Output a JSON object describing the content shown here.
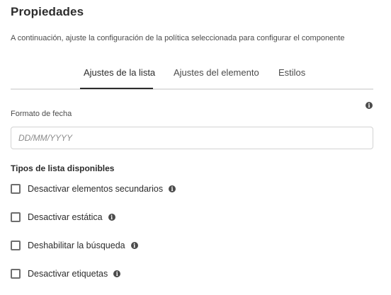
{
  "header": {
    "title": "Propiedades",
    "description": "A continuación, ajuste la configuración de la política seleccionada para configurar el componente"
  },
  "tabs": [
    {
      "label": "Ajustes de la lista",
      "active": true
    },
    {
      "label": "Ajustes del elemento",
      "active": false
    },
    {
      "label": "Estilos",
      "active": false
    }
  ],
  "date_format": {
    "label": "Formato de fecha",
    "placeholder": "DD/MM/YYYY",
    "value": "",
    "info_icon": "info-icon"
  },
  "list_types": {
    "heading": "Tipos de lista disponibles",
    "options": [
      {
        "label": "Desactivar elementos secundarios",
        "checked": false
      },
      {
        "label": "Desactivar estática",
        "checked": false
      },
      {
        "label": "Deshabilitar la búsqueda",
        "checked": false
      },
      {
        "label": "Desactivar etiquetas",
        "checked": false
      }
    ]
  },
  "colors": {
    "text": "#2c2c2c",
    "muted": "#4b4b4b",
    "border": "#d3d3d3",
    "divider": "#e1e1e1"
  }
}
